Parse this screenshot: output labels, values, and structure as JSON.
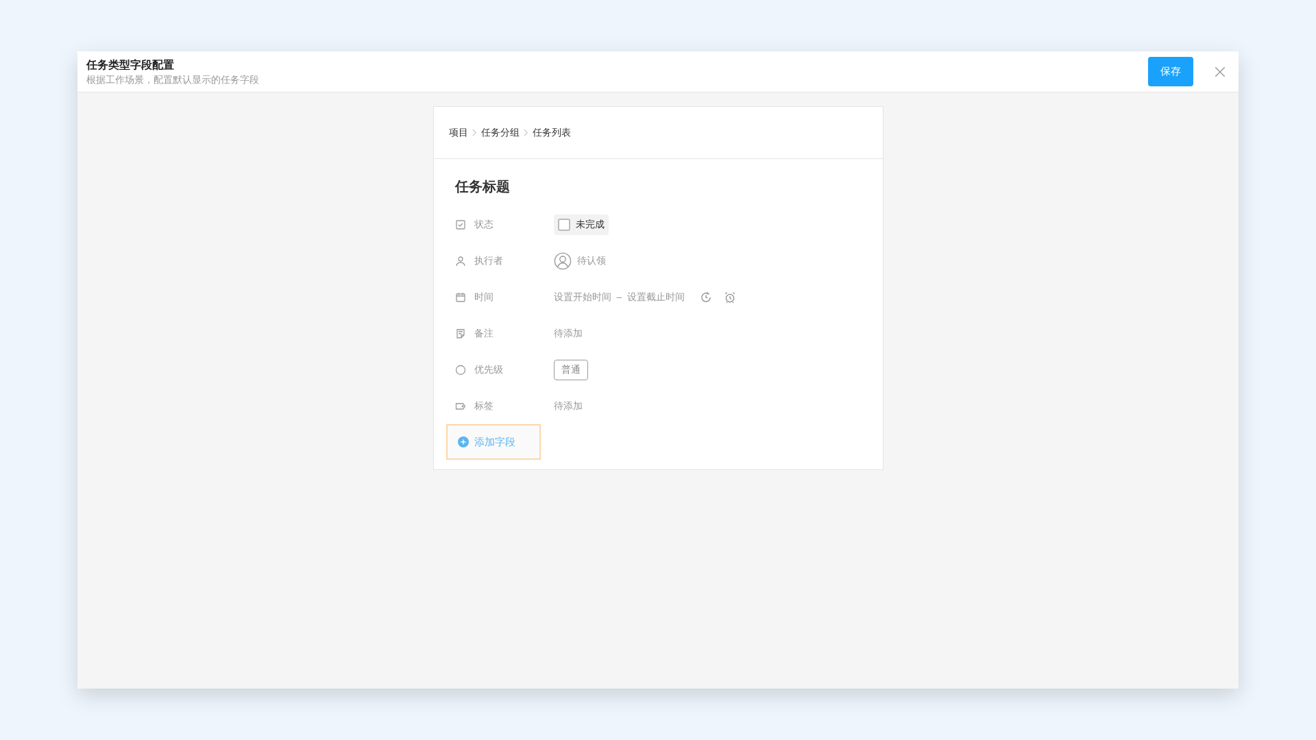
{
  "dialog": {
    "title": "任务类型字段配置",
    "subtitle": "根据工作场景，配置默认显示的任务字段",
    "save_button": "保存"
  },
  "breadcrumb": [
    "项目",
    "任务分组",
    "任务列表"
  ],
  "task_title": "任务标题",
  "fields": [
    {
      "kind": "status",
      "label": "状态",
      "value": "未完成",
      "checked": false
    },
    {
      "kind": "assignee",
      "label": "执行者",
      "value": "待认领"
    },
    {
      "kind": "time",
      "label": "时间",
      "start": "设置开始时间",
      "separator": "–",
      "end": "设置截止时间"
    },
    {
      "kind": "note",
      "label": "备注",
      "value": "待添加"
    },
    {
      "kind": "priority",
      "label": "优先级",
      "value": "普通"
    },
    {
      "kind": "tag",
      "label": "标签",
      "value": "待添加"
    }
  ],
  "add_field": "添加字段"
}
